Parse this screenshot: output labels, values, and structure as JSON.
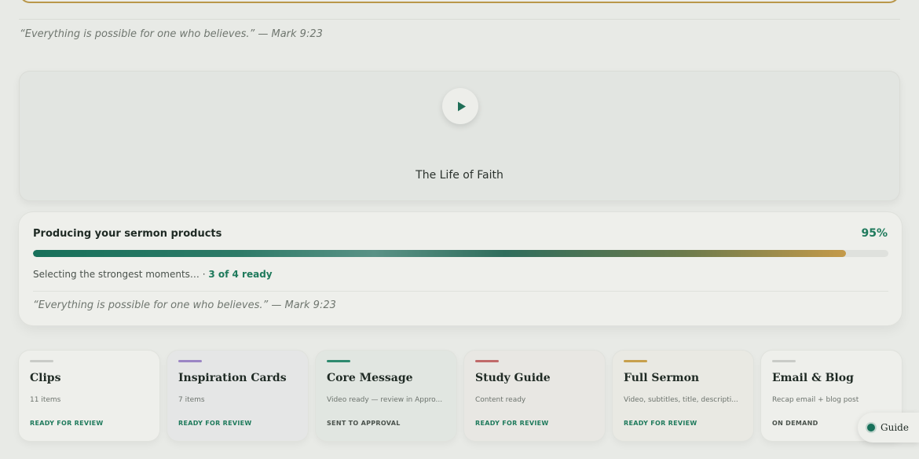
{
  "quote_top": "“Everything is possible for one who believes.” — Mark 9:23",
  "video": {
    "title": "The Life of Faith",
    "play_icon": "play-icon"
  },
  "progress": {
    "title": "Producing your sermon products",
    "percent_label": "95%",
    "percent_value": 0.95,
    "status_text": "Selecting the strongest moments… · ",
    "ready_text": "3 of 4 ready",
    "quote": "“Everything is possible for one who believes.” — Mark 9:23"
  },
  "cards": [
    {
      "name": "Clips",
      "sub": "11 items",
      "status": "READY FOR REVIEW",
      "accent": "#c9cbc7",
      "bg": "#eeefeb",
      "status_color": "#1f7a5c"
    },
    {
      "name": "Inspiration Cards",
      "sub": "7 items",
      "status": "READY FOR REVIEW",
      "accent": "#9b86c4",
      "bg": "#e5e6e6",
      "status_color": "#1f7a5c"
    },
    {
      "name": "Core Message",
      "sub": "Video ready — review in Appro...",
      "status": "SENT TO APPROVAL",
      "accent": "#2e8a6e",
      "bg": "#e1e6e1",
      "status_color": "#4a524c"
    },
    {
      "name": "Study Guide",
      "sub": "Content ready",
      "status": "READY FOR REVIEW",
      "accent": "#c06a6a",
      "bg": "#e8e7e3",
      "status_color": "#1f7a5c"
    },
    {
      "name": "Full Sermon",
      "sub": "Video, subtitles, title, descripti...",
      "status": "READY FOR REVIEW",
      "accent": "#c7a04d",
      "bg": "#e9e9e3",
      "status_color": "#1f7a5c"
    },
    {
      "name": "Email & Blog",
      "sub": "Recap email + blog post",
      "status": "ON DEMAND",
      "accent": "#c9cbc7",
      "bg": "#eeefeb",
      "status_color": "#4a524c"
    }
  ],
  "guide": {
    "label": "Guide"
  }
}
